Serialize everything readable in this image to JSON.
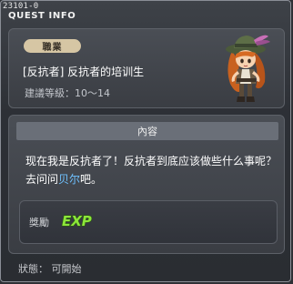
{
  "window": {
    "quest_id": "23101-0",
    "title": "QUEST INFO"
  },
  "quest": {
    "job_tag": "職業",
    "name": "[反抗者] 反抗者的培训生",
    "level_requirement": "建議等級：10～14"
  },
  "content": {
    "header": "內容",
    "text_before": "现在我是反抗者了！反抗者到底应该做些什么事呢？去问问",
    "npc_name": "贝尔",
    "text_after": "吧。"
  },
  "reward": {
    "label": "獎勵",
    "exp_text": "EXP"
  },
  "status": {
    "text": "狀態： 可開始"
  },
  "colors": {
    "npc_highlight": "#6fc1ff",
    "exp_green": "#8ce63a",
    "job_tag_bg": "#d6c6a4"
  }
}
